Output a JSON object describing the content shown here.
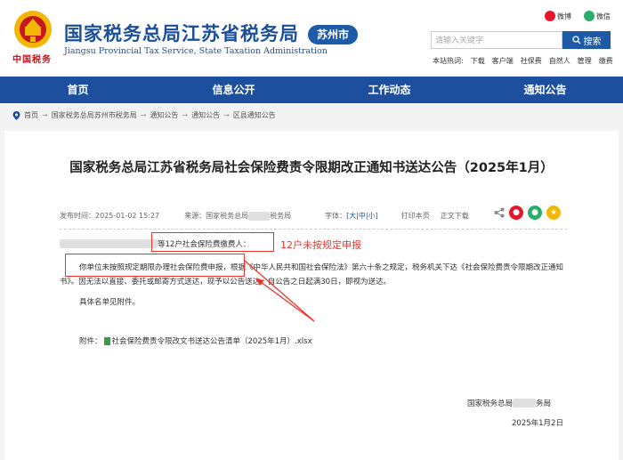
{
  "header": {
    "title": "国家税务总局江苏省税务局",
    "city_badge": "苏州市",
    "subtitle_en": "Jiangsu Provincial Tax Service, State Taxation Administration",
    "logo_caption": "中国税务",
    "social": {
      "weibo": "微博",
      "wechat": "微信"
    },
    "search": {
      "placeholder": "请输入关键字",
      "button": "搜索"
    },
    "hot_label": "本站热词:",
    "hot_words": [
      "下载",
      "客户端",
      "社保费",
      "自然人",
      "管理",
      "缴费"
    ]
  },
  "nav": {
    "items": [
      "首页",
      "信息公开",
      "工作动态",
      "通知公告"
    ]
  },
  "breadcrumb": [
    "首页",
    "国家税务总局苏州市税务局",
    "通知公告",
    "通知公告",
    "区县通知公告"
  ],
  "article": {
    "title": "国家税务总局江苏省税务局社会保险费责令限期改正通知书送达公告（2025年1月）",
    "publish_label": "发布时间：",
    "publish_time": "2025-01-02 15:27",
    "source_label": "来源：",
    "source": "国家税务总局",
    "source_tail": "税务局",
    "font_label": "字体：",
    "font_sizes": [
      "大",
      "中",
      "小"
    ],
    "print_label": "打印本页",
    "download_label": "正文下载",
    "salutation_tail": "等12户社会保险费缴费人：",
    "body_lead": "你单位未按照规定期限办理社会保险费申报，",
    "body_rest": "根据《中华人民共和国社会保险法》第六十条之规定，税务机关下达《社会保险费责令限期改正通知书》。因无法以直接、委托或邮寄方式送达，现予以公告送达。自公告之日起满30日，即视为送达。",
    "list_note": "具体名单见附件。",
    "attachment_label": "附件：",
    "attachment": "社会保险费责令限改文书送达公告清单（2025年1月）.xlsx",
    "signature_head": "国家税务总局",
    "signature_tail": "务局",
    "date": "2025年1月2日"
  },
  "annotation": {
    "text": "12户未按规定申报"
  },
  "colors": {
    "brand_blue": "#1c4f9d",
    "red": "#e8362c"
  }
}
